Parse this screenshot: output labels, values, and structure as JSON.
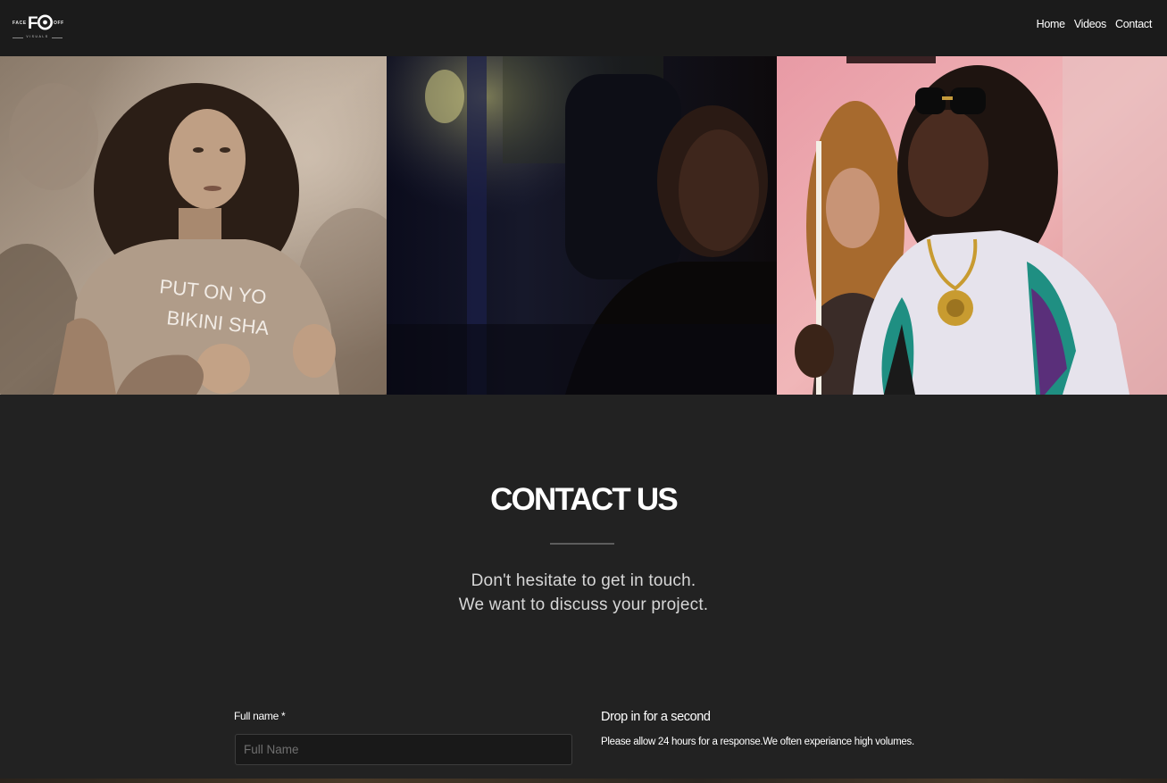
{
  "header": {
    "logo": {
      "left_text": "FACE",
      "mark": "FO",
      "right_text": "OFF",
      "sub_text": "VISUALS"
    },
    "nav": [
      "Home",
      "Videos",
      "Contact"
    ]
  },
  "gallery": {
    "photos": [
      {
        "name": "woman in graphic t-shirt, sepia",
        "shirt_text": "PUT ON YO",
        "shirt_text_2": "BIKINI SHA"
      },
      {
        "name": "man in dark car interior"
      },
      {
        "name": "man in sunglasses and jacket with woman"
      }
    ]
  },
  "contact": {
    "heading": "CONTACT US",
    "intro_line1": "Don't hesitate to get in touch.",
    "intro_line2": "We want to discuss your project.",
    "form": {
      "full_name_label": "Full name *",
      "full_name_placeholder": "Full Name"
    },
    "aside": {
      "title": "Drop in for a second",
      "text": "Please allow 24 hours for a response.We often experiance high volumes."
    }
  },
  "colors": {
    "page_bg": "#222222",
    "header_bg": "#1b1b1b",
    "text": "#ffffff",
    "muted_text": "#d7d7d7"
  }
}
